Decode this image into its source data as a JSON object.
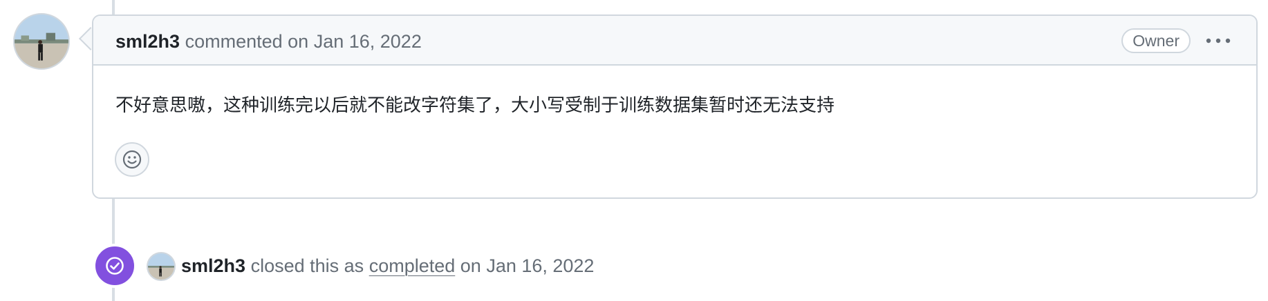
{
  "comment": {
    "author": "sml2h3",
    "action": "commented on",
    "date": "Jan 16, 2022",
    "badge": "Owner",
    "body": "不好意思嗷，这种训练完以后就不能改字符集了，大小写受制于训练数据集暂时还无法支持",
    "more_icon": "kebab-horizontal-icon",
    "reaction_icon": "smiley-icon"
  },
  "event": {
    "actor": "sml2h3",
    "text_before": "closed this as",
    "link": "completed",
    "text_after": "on Jan 16, 2022",
    "icon": "check-circle-icon",
    "color": "#8250df"
  },
  "colors": {
    "border": "#d0d7de",
    "header_bg": "#f6f8fa",
    "muted_text": "#656d76",
    "text": "#1f2328",
    "closed_purple": "#8250df"
  }
}
